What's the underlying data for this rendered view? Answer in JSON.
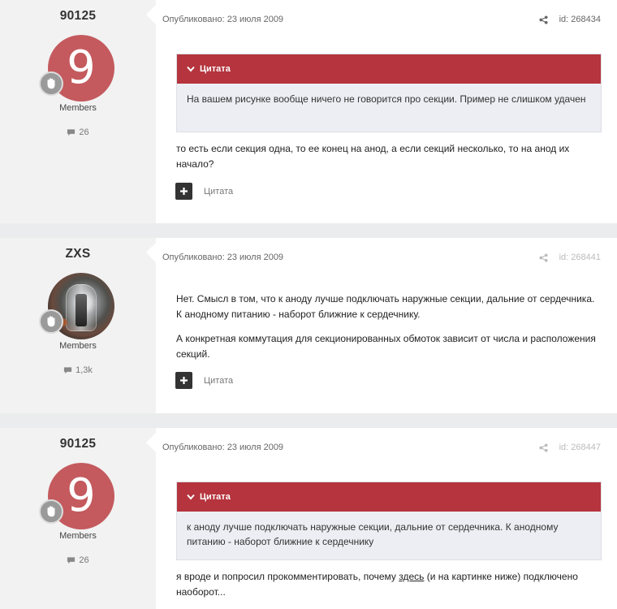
{
  "posts": [
    {
      "author": "90125",
      "avatar_letter": "9",
      "group": "Members",
      "post_count": "26",
      "published": "Опубликовано: 23 июля 2009",
      "post_id": "id: 268434",
      "quote": {
        "label": "Цитата",
        "text": "На вашем рисунке вообще ничего не говорится про секции. Пример не слишком удачен"
      },
      "paragraphs": [
        "то есть если секция одна, то ее конец на анод, а если секций несколько, то на анод их начало?"
      ],
      "quote_action": "Цитата"
    },
    {
      "author": "ZXS",
      "group": "Members",
      "post_count": "1,3k",
      "published": "Опубликовано: 23 июля 2009",
      "post_id": "id: 268441",
      "paragraphs": [
        "Нет. Смысл в том, что к аноду лучше подключать наружные секции, дальние от сердечника. К анодному питанию - наборот ближние к сердечнику.",
        "А конкретная коммутация для секционированных обмоток зависит от числа и расположения секций."
      ],
      "quote_action": "Цитата"
    },
    {
      "author": "90125",
      "avatar_letter": "9",
      "group": "Members",
      "post_count": "26",
      "published": "Опубликовано: 23 июля 2009",
      "post_id": "id: 268447",
      "quote": {
        "label": "Цитата",
        "text": "к аноду лучше подключать наружные секции, дальние от сердечника. К анодному питанию - наборот ближние к сердечнику"
      },
      "paragraph_parts": {
        "before": "я вроде и попросил прокомментировать, почему ",
        "link": "здесь",
        "after": " (и на картинке ниже) подключено наоборот..."
      }
    }
  ],
  "icons": {
    "share": "share-icon",
    "comment": "comment-icon",
    "rank_badge": "hand-badge-icon",
    "plus": "plus-icon",
    "chevron": "chevron-down-icon"
  },
  "colors": {
    "quote_header": "#b5343d",
    "avatar_bg": "#c45a5e",
    "sidebar_bg": "#f2f2f2"
  }
}
